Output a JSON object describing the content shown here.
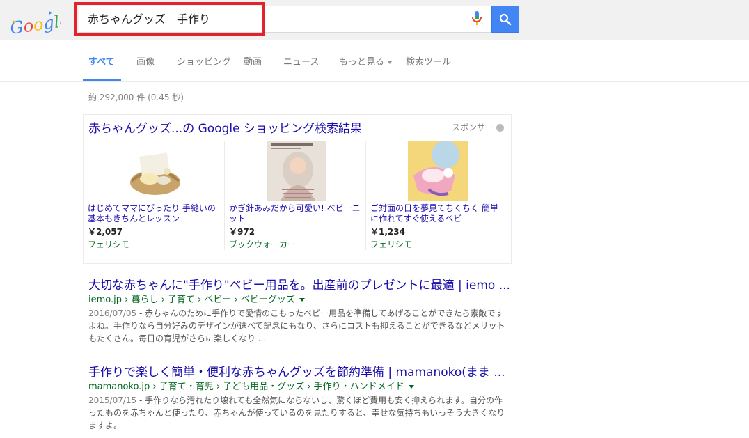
{
  "header": {
    "logo_text": "Google",
    "search_query": "赤ちゃんグッズ　手作り"
  },
  "tabs": [
    {
      "label": "すべて",
      "active": true
    },
    {
      "label": "画像"
    },
    {
      "label": "ショッピング"
    },
    {
      "label": "動画"
    },
    {
      "label": "ニュース"
    },
    {
      "label": "もっと見る"
    },
    {
      "label": "検索ツール"
    }
  ],
  "result_stats": "約 292,000 件 (0.45 秒)",
  "shopping": {
    "title": "赤ちゃんグッズ...の Google ショッピング検索結果",
    "sponsor_label": "スポンサー",
    "products": [
      {
        "name": "はじめてママにぴったり 手縫いの基本もきちんとレッスン",
        "price": "￥2,057",
        "seller": "フェリシモ"
      },
      {
        "name": "かぎ針あみだから可愛い! ベビーニット",
        "price": "￥972",
        "seller": "ブックウォーカー"
      },
      {
        "name": "ご対面の日を夢見てちくちく 簡単に作れてすぐ使えるベビ",
        "price": "￥1,234",
        "seller": "フェリシモ"
      }
    ]
  },
  "results": [
    {
      "title": "大切な赤ちゃんに\"手作り\"ベビー用品を。出産前のプレゼントに最適 | iemo ...",
      "url": "iemo.jp › 暮らし › 子育て › ベビー › ベビーグッズ",
      "date": "2016/07/05",
      "snippet": " - 赤ちゃんのために手作りで愛情のこもったベビー用品を準備してあげることができたら素敵ですよね。手作りなら自分好みのデザインが選べて記念にもなり、さらにコストも抑えることができるなどメリットもたくさん。毎日の育児がさらに楽しくなり ..."
    },
    {
      "title": "手作りで楽しく簡単・便利な赤ちゃんグッズを節約準備 | mamanoko(まま ...",
      "url": "mamanoko.jp › 子育て・育児 › 子ども用品・グッズ › 手作り・ハンドメイド",
      "date": "2015/07/15",
      "snippet": " - 手作りなら汚れたり壊れても全然気にならないし、驚くほど費用も安く抑えられます。自分の作ったものを赤ちゃんと使ったり、赤ちゃんが使っているのを見たりすると、幸せな気持ちもいっそう大きくなりますよ。"
    }
  ],
  "colors": {
    "accent": "#4285f4",
    "link": "#1a0dab",
    "url_green": "#006621",
    "highlight_red": "#e3232b"
  }
}
